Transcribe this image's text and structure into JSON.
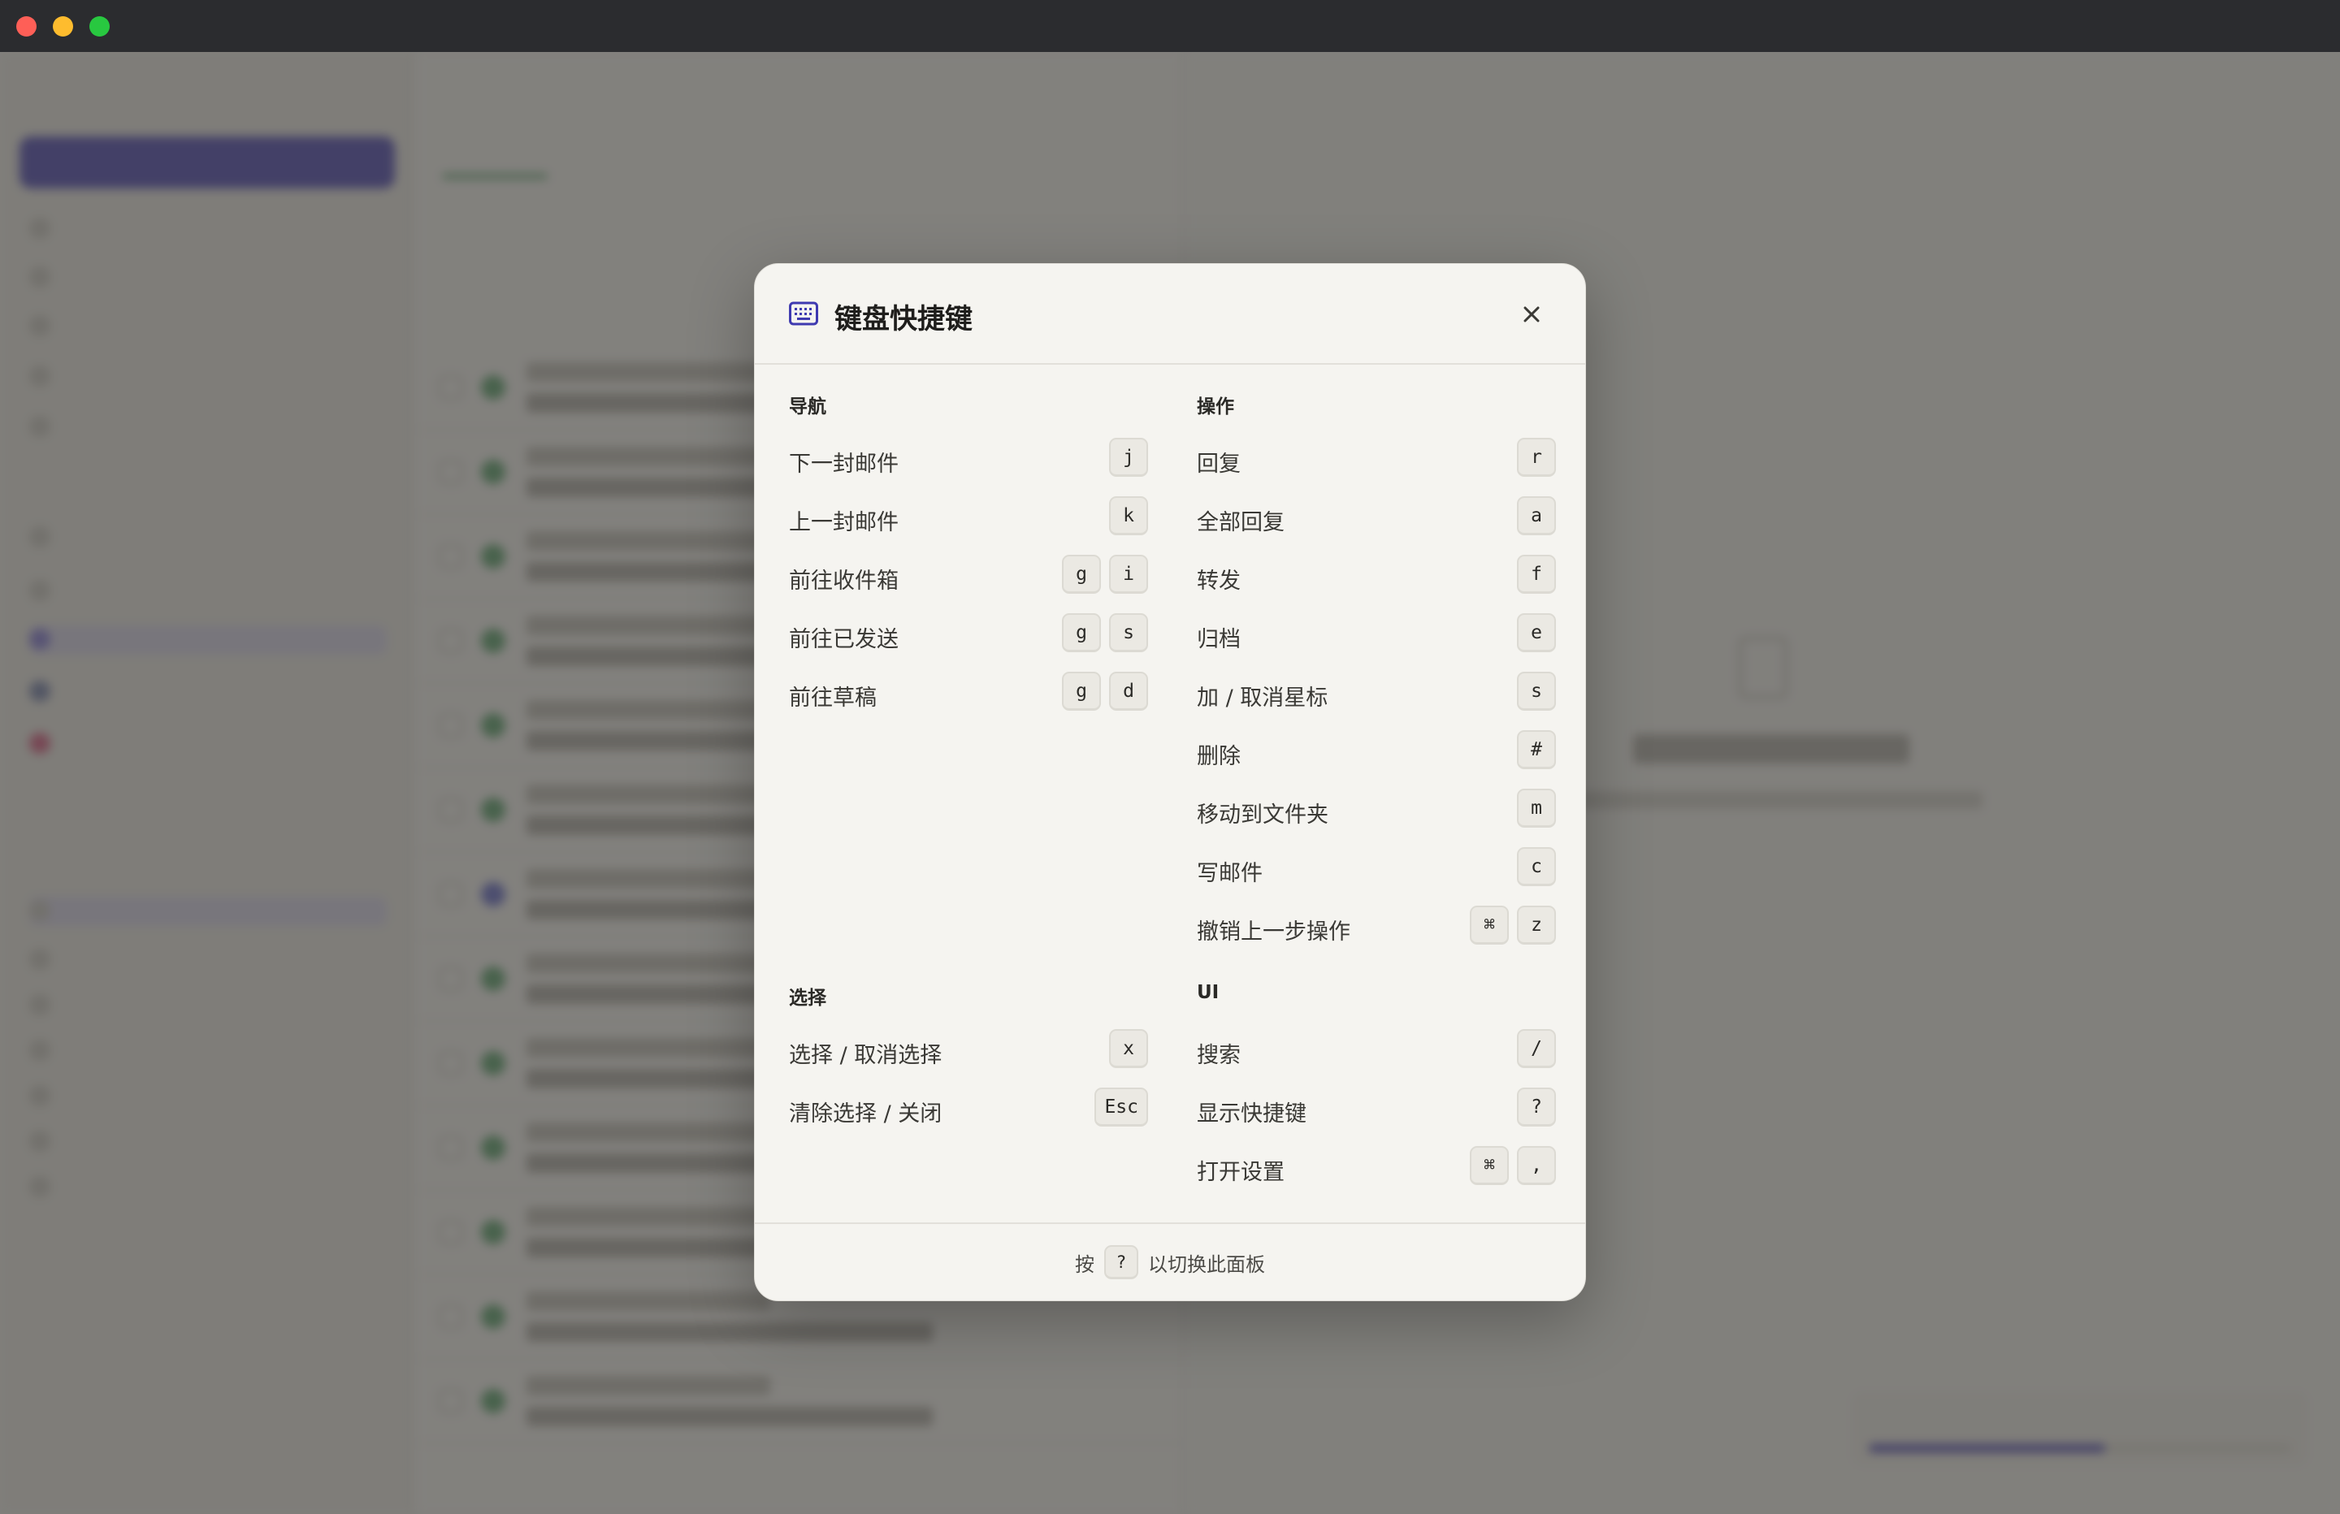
{
  "modal": {
    "title": "键盘快捷键",
    "footer_prefix": "按",
    "footer_key": "?",
    "footer_suffix": "以切换此面板"
  },
  "sections": {
    "navigation": {
      "title": "导航",
      "items": [
        {
          "label": "下一封邮件",
          "keys": [
            "j"
          ]
        },
        {
          "label": "上一封邮件",
          "keys": [
            "k"
          ]
        },
        {
          "label": "前往收件箱",
          "keys": [
            "g",
            "i"
          ]
        },
        {
          "label": "前往已发送",
          "keys": [
            "g",
            "s"
          ]
        },
        {
          "label": "前往草稿",
          "keys": [
            "g",
            "d"
          ]
        }
      ]
    },
    "actions": {
      "title": "操作",
      "items": [
        {
          "label": "回复",
          "keys": [
            "r"
          ]
        },
        {
          "label": "全部回复",
          "keys": [
            "a"
          ]
        },
        {
          "label": "转发",
          "keys": [
            "f"
          ]
        },
        {
          "label": "归档",
          "keys": [
            "e"
          ]
        },
        {
          "label": "加 / 取消星标",
          "keys": [
            "s"
          ]
        },
        {
          "label": "删除",
          "keys": [
            "#"
          ]
        },
        {
          "label": "移动到文件夹",
          "keys": [
            "m"
          ]
        },
        {
          "label": "写邮件",
          "keys": [
            "c"
          ]
        },
        {
          "label": "撤销上一步操作",
          "keys": [
            "⌘",
            "z"
          ]
        }
      ]
    },
    "selection": {
      "title": "选择",
      "items": [
        {
          "label": "选择 / 取消选择",
          "keys": [
            "x"
          ]
        },
        {
          "label": "清除选择 / 关闭",
          "keys": [
            "Esc"
          ]
        }
      ]
    },
    "ui": {
      "title": "UI",
      "items": [
        {
          "label": "搜索",
          "keys": [
            "/"
          ]
        },
        {
          "label": "显示快捷键",
          "keys": [
            "?"
          ]
        },
        {
          "label": "打开设置",
          "keys": [
            "⌘",
            ","
          ]
        }
      ]
    }
  },
  "colors": {
    "accent": "#3f3ab0",
    "overlay": "#464542",
    "modal_bg": "#f5f4f0"
  },
  "icons": {
    "header": "keyboard-icon",
    "close": "close-icon"
  }
}
